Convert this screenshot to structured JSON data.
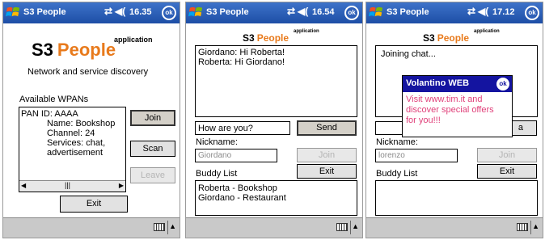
{
  "screen1": {
    "title": "S3 People",
    "time": "16.35",
    "ok": "ok",
    "logo_main": "S3 People",
    "logo_sub": "application",
    "subtitle": "Network and service discovery",
    "wpan_label": "Available WPANs",
    "wpan_lines": [
      "PAN ID: AAAA",
      "Name: Bookshop",
      "Channel: 24",
      "Services: chat,",
      "advertisement"
    ],
    "join": "Join",
    "scan": "Scan",
    "leave": "Leave",
    "exit": "Exit"
  },
  "screen2": {
    "title": "S3 People",
    "time": "16.54",
    "ok": "ok",
    "logo_main": "S3 People",
    "logo_sub": "application",
    "chat_lines": [
      "Giordano: Hi Roberta!",
      "Roberta: Hi Giordano!"
    ],
    "message_value": "How are you?",
    "send": "Send",
    "nickname_label": "Nickname:",
    "nickname_value": "Giordano",
    "join": "Join",
    "exit": "Exit",
    "buddy_label": "Buddy List",
    "buddies": [
      "Roberta - Bookshop",
      "Giordano - Restaurant"
    ]
  },
  "screen3": {
    "title": "S3 People",
    "time": "17.12",
    "ok": "ok",
    "logo_main": "S3 People",
    "logo_sub": "application",
    "chat_status": "Joining chat...",
    "send_partial": "a",
    "nickname_label": "Nickname:",
    "nickname_value": "lorenzo",
    "join": "Join",
    "exit": "Exit",
    "buddy_label": "Buddy List",
    "popup": {
      "title": "Volantino WEB",
      "ok": "ok",
      "lines": [
        "Visit www.tim.it and",
        "discover special offers",
        "for you!!!"
      ]
    }
  },
  "colors": {
    "titlebar": "#1d4ea6",
    "logo_orange": "#e87a1c",
    "popup_text": "#e0407a",
    "popup_title": "#1414a0"
  }
}
